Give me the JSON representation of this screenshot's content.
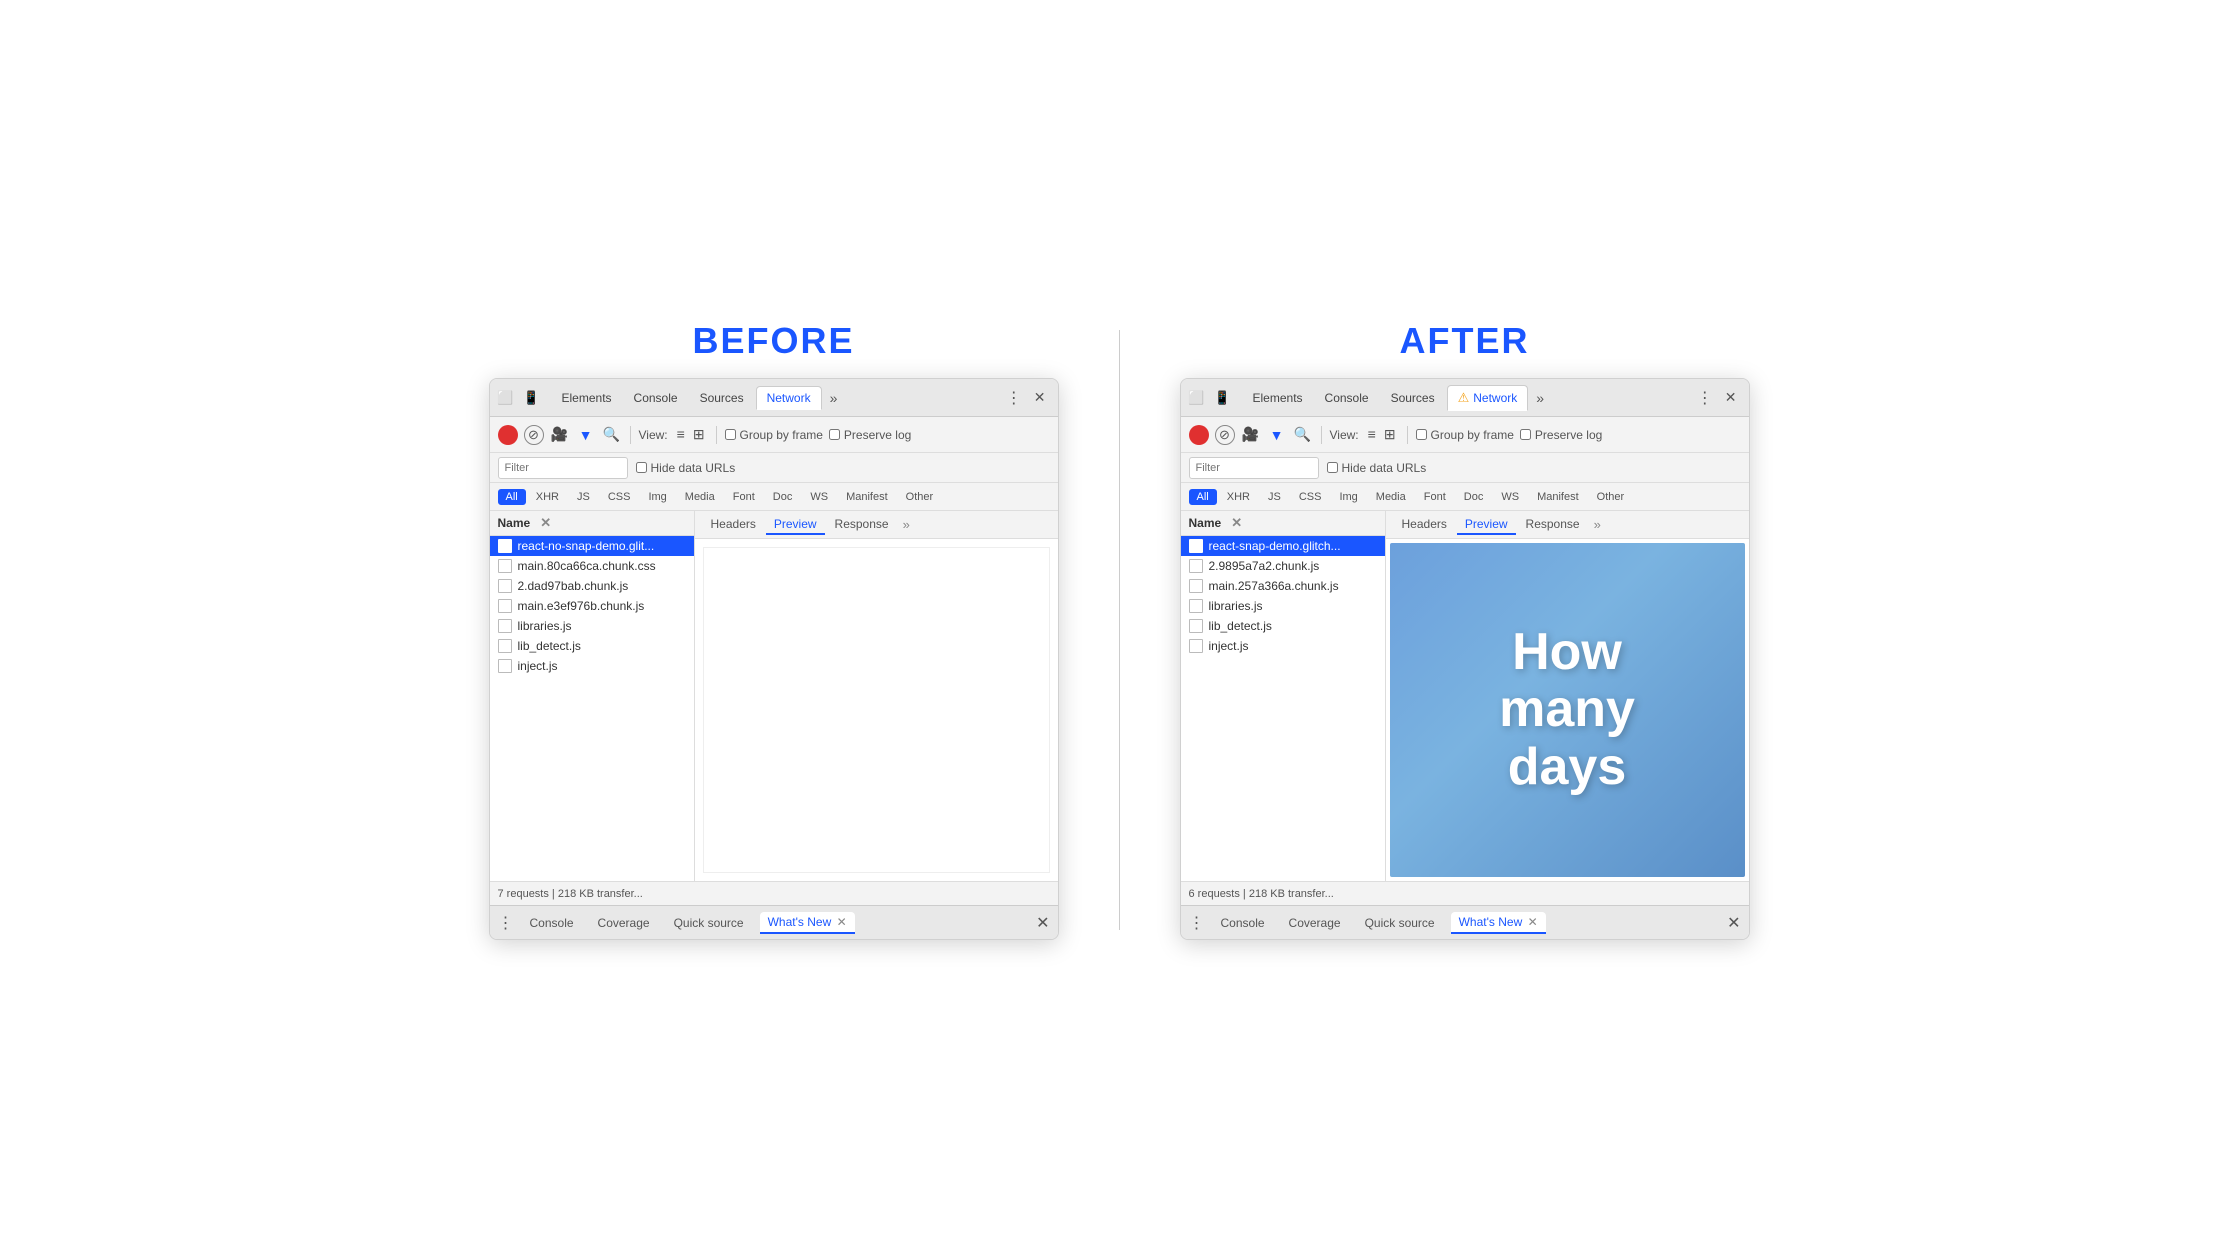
{
  "before": {
    "label": "BEFORE",
    "tabs": {
      "items": [
        "Elements",
        "Console",
        "Sources",
        "Network",
        "»"
      ],
      "active": "Network",
      "active_index": 3
    },
    "toolbar": {
      "view_label": "View:",
      "group_by_frame": "Group by frame",
      "preserve_log": "Preserve log"
    },
    "filter": {
      "placeholder": "Filter",
      "hide_data_urls": "Hide data URLs"
    },
    "type_buttons": [
      "All",
      "XHR",
      "JS",
      "CSS",
      "Img",
      "Media",
      "Font",
      "Doc",
      "WS",
      "Manifest",
      "Other"
    ],
    "active_type": "All",
    "file_list": {
      "header": "Name",
      "files": [
        "react-no-snap-demo.glit...",
        "main.80ca66ca.chunk.css",
        "2.dad97bab.chunk.js",
        "main.e3ef976b.chunk.js",
        "libraries.js",
        "lib_detect.js",
        "inject.js"
      ],
      "selected_index": 0
    },
    "detail_tabs": [
      "Headers",
      "Preview",
      "Response",
      "»"
    ],
    "active_detail_tab": "Preview",
    "preview": "blank",
    "status": "7 requests | 218 KB transfer...",
    "drawer_tabs": [
      "Console",
      "Coverage",
      "Quick source",
      "What's New"
    ],
    "active_drawer_tab": "What's New"
  },
  "after": {
    "label": "AFTER",
    "tabs": {
      "items": [
        "Elements",
        "Console",
        "Sources",
        "Network",
        "»"
      ],
      "active": "Network",
      "active_index": 3
    },
    "toolbar": {
      "view_label": "View:",
      "group_by_frame": "Group by frame",
      "preserve_log": "Preserve log"
    },
    "filter": {
      "placeholder": "Filter",
      "hide_data_urls": "Hide data URLs"
    },
    "type_buttons": [
      "All",
      "XHR",
      "JS",
      "CSS",
      "Img",
      "Media",
      "Font",
      "Doc",
      "WS",
      "Manifest",
      "Other"
    ],
    "active_type": "All",
    "file_list": {
      "header": "Name",
      "files": [
        "react-snap-demo.glitch...",
        "2.9895a7a2.chunk.js",
        "main.257a366a.chunk.js",
        "libraries.js",
        "lib_detect.js",
        "inject.js"
      ],
      "selected_index": 0
    },
    "detail_tabs": [
      "Headers",
      "Preview",
      "Response",
      "»"
    ],
    "active_detail_tab": "Preview",
    "preview": "image",
    "preview_text": "How\nmany\ndays",
    "status": "6 requests | 218 KB transfer...",
    "drawer_tabs": [
      "Console",
      "Coverage",
      "Quick source",
      "What's New"
    ],
    "active_drawer_tab": "What's New"
  }
}
